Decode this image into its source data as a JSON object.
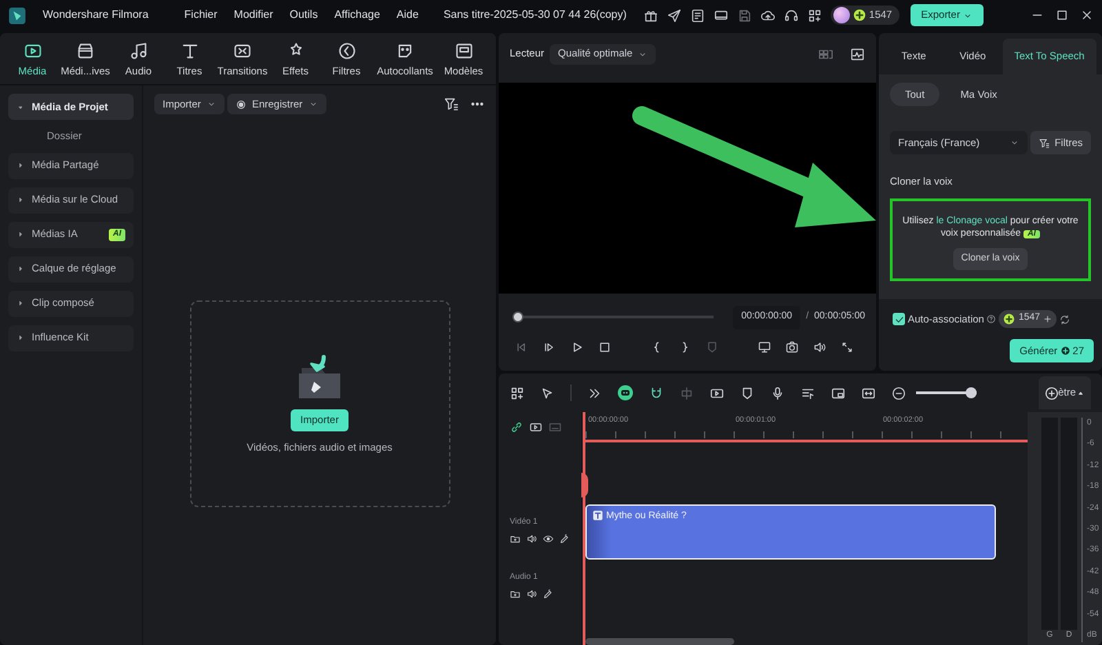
{
  "app": {
    "name": "Wondershare Filmora"
  },
  "menu": [
    "Fichier",
    "Modifier",
    "Outils",
    "Affichage",
    "Aide"
  ],
  "project_title": "Sans titre-2025-05-30 07 44 26(copy)",
  "credits": "1547",
  "export_button": "Exporter",
  "media_tabs": [
    {
      "label": "Média",
      "selected": true
    },
    {
      "label": "Médi...ives",
      "selected": false
    },
    {
      "label": "Audio",
      "selected": false
    },
    {
      "label": "Titres",
      "selected": false
    },
    {
      "label": "Transitions",
      "selected": false
    },
    {
      "label": "Effets",
      "selected": false
    },
    {
      "label": "Filtres",
      "selected": false
    },
    {
      "label": "Autocollants",
      "selected": false
    },
    {
      "label": "Modèles",
      "selected": false
    }
  ],
  "sidebar": [
    {
      "label": "Média de Projet",
      "expanded": true,
      "selected": true,
      "children": [
        {
          "label": "Dossier"
        }
      ]
    },
    {
      "label": "Média Partagé",
      "expanded": false,
      "selected": false
    },
    {
      "label": "Média sur le Cloud",
      "expanded": false,
      "selected": false
    },
    {
      "label": "Médias IA",
      "expanded": false,
      "selected": false,
      "badge": "AI"
    },
    {
      "label": "Calque de réglage",
      "expanded": false,
      "selected": false
    },
    {
      "label": "Clip composé",
      "expanded": false,
      "selected": false
    },
    {
      "label": "Influence Kit",
      "expanded": false,
      "selected": false
    }
  ],
  "media_toolbar": {
    "import": "Importer",
    "record": "Enregistrer"
  },
  "drop_zone": {
    "button": "Importer",
    "hint": "Vidéos, fichiers audio et images"
  },
  "player": {
    "label": "Lecteur",
    "quality": "Qualité optimale",
    "progress": {
      "level": 0
    },
    "current_time": "00:00:00:00",
    "separator": "/",
    "total_time": "00:00:05:00"
  },
  "right_panel": {
    "tabs": [
      {
        "label": "Texte",
        "selected": false
      },
      {
        "label": "Vidéo",
        "selected": false
      },
      {
        "label": "Text To Speech",
        "selected": true
      }
    ],
    "voice_filters": [
      {
        "label": "Tout",
        "selected": true
      },
      {
        "label": "Ma Voix",
        "selected": false
      }
    ],
    "language": "Français (France)",
    "filter_button": "Filtres",
    "section_title": "Cloner la voix",
    "clone_card": {
      "highlighted": true,
      "before": "Utilisez",
      "link": "le Clonage vocal",
      "after": "pour créer votre voix personnalisée",
      "badge": "AI",
      "button": "Cloner la voix"
    },
    "auto_association": {
      "label": "Auto-association",
      "checked": true,
      "credits": "1547"
    },
    "generate": {
      "label": "Générer",
      "cost": "27"
    }
  },
  "timeline": {
    "zoom": {
      "level": 0.92
    },
    "meter_label": "ètre",
    "ruler": [
      "00:00:00:00",
      "00:00:01:00",
      "00:00:02:00"
    ],
    "tracks": [
      {
        "label": "Vidéo 1",
        "kind": "video",
        "clips": [
          {
            "title": "Mythe ou Réalité ?"
          }
        ]
      },
      {
        "label": "Audio 1",
        "kind": "audio"
      }
    ],
    "meter": {
      "scale": [
        "0",
        "-6",
        "-12",
        "-18",
        "-24",
        "-30",
        "-36",
        "-42",
        "-48",
        "-54"
      ],
      "unit": "dB",
      "channels": [
        "G",
        "D"
      ]
    }
  }
}
